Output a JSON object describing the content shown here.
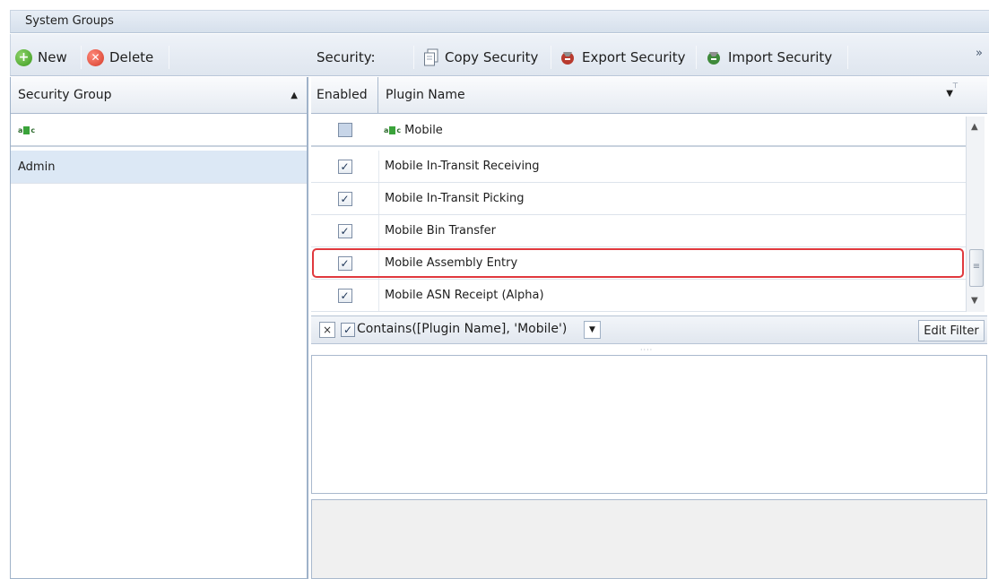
{
  "window": {
    "title": "System Groups"
  },
  "toolbar": {
    "new_label": "New",
    "delete_label": "Delete",
    "security_label": "Security:",
    "copy_label": "Copy Security",
    "export_label": "Export Security",
    "import_label": "Import Security",
    "overflow_label": "»"
  },
  "left_grid": {
    "header": "Security Group",
    "sort_indicator": "▲",
    "filter_row_icon": "abc-filter-icon",
    "rows": [
      {
        "name": "Admin"
      }
    ]
  },
  "right_grid": {
    "headers": {
      "enabled": "Enabled",
      "plugin_name": "Plugin Name"
    },
    "filter_row": {
      "value": "Mobile",
      "checked": false
    },
    "rows": [
      {
        "checked": true,
        "name": "Mobile In-Transit Receiving",
        "highlighted": false
      },
      {
        "checked": true,
        "name": "Mobile In-Transit Picking",
        "highlighted": false
      },
      {
        "checked": true,
        "name": "Mobile Bin Transfer",
        "highlighted": false
      },
      {
        "checked": true,
        "name": "Mobile Assembly Entry",
        "highlighted": true
      },
      {
        "checked": true,
        "name": "Mobile ASN Receipt (Alpha)",
        "highlighted": false
      }
    ]
  },
  "filter_panel": {
    "close_glyph": "×",
    "active": true,
    "expression": "Contains([Plugin Name], 'Mobile')",
    "edit_label": "Edit Filter"
  },
  "colors": {
    "highlight_border": "#e0393e",
    "selected_row": "#dce8f5",
    "accent": "#3b6fb6"
  }
}
